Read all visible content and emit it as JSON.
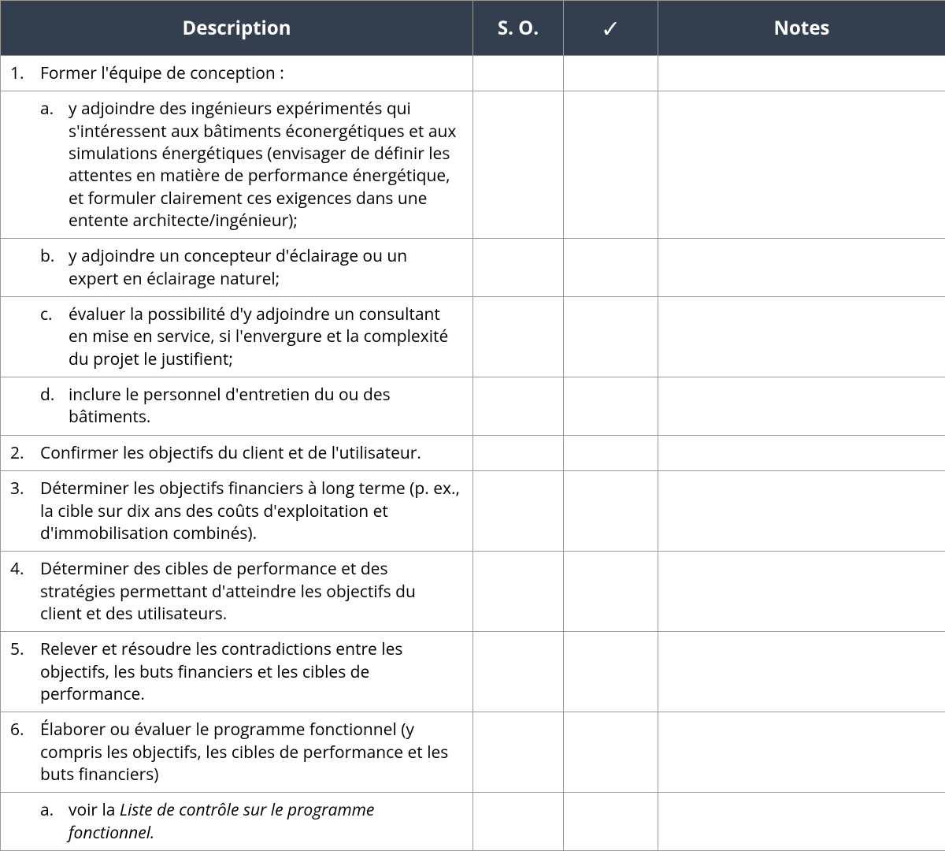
{
  "headers": {
    "description": "Description",
    "so": "S. O.",
    "check": "✓",
    "notes": "Notes"
  },
  "rows": [
    {
      "type": "main",
      "marker": "1.",
      "text": "Former l'équipe de conception :"
    },
    {
      "type": "sub",
      "marker": "a.",
      "text": "y adjoindre des ingénieurs expérimentés qui s'intéressent aux bâtiments éconergétiques et aux simulations énergétiques (envisager de définir les attentes en matière de performance énergétique, et formuler clairement ces exigences dans une entente architecte/ingénieur);"
    },
    {
      "type": "sub",
      "marker": "b.",
      "text": "y adjoindre un concepteur d'éclairage ou un expert en éclairage naturel;"
    },
    {
      "type": "sub",
      "marker": "c.",
      "text": "évaluer la possibilité d'y adjoindre un consultant en mise en service, si l'envergure et la complexité du projet le justifient;"
    },
    {
      "type": "sub",
      "marker": "d.",
      "text": "inclure le personnel d'entretien du ou des bâtiments."
    },
    {
      "type": "main",
      "marker": "2.",
      "text": "Confirmer les objectifs du client et de l'utilisateur."
    },
    {
      "type": "main",
      "marker": "3.",
      "text": "Déterminer les objectifs financiers à long terme (p. ex., la cible sur dix ans des coûts d'exploitation et d'immobilisation combinés)."
    },
    {
      "type": "main",
      "marker": "4.",
      "text": "Déterminer des cibles de performance et des stratégies permettant d'atteindre les objectifs du client et des utilisateurs."
    },
    {
      "type": "main",
      "marker": "5.",
      "text": "Relever et résoudre les contradictions entre les objectifs, les buts financiers et les cibles de performance."
    },
    {
      "type": "main",
      "marker": "6.",
      "text": "Élaborer ou évaluer le programme fonctionnel (y compris les objectifs, les cibles de performance et les buts financiers)"
    },
    {
      "type": "sub",
      "marker": "a.",
      "text_prefix": "voir la ",
      "text_italic": "Liste de contrôle sur le programme fonctionnel."
    }
  ]
}
